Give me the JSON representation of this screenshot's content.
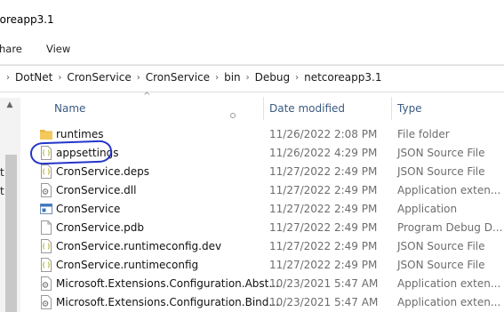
{
  "window": {
    "title": "coreapp3.1"
  },
  "ribbon": {
    "tabs": [
      "hare",
      "View"
    ]
  },
  "address": {
    "crumbs": [
      "DotNet",
      "CronService",
      "CronService",
      "bin",
      "Debug",
      "netcoreapp3.1"
    ]
  },
  "nav_pane": {
    "letters": [
      "t",
      "t"
    ]
  },
  "columns": {
    "name": "Name",
    "date": "Date modified",
    "type": "Type"
  },
  "files": [
    {
      "name": "runtimes",
      "date": "11/26/2022 2:08 PM",
      "type": "File folder",
      "icon": "folder-icon"
    },
    {
      "name": "appsettings",
      "date": "11/26/2022 4:29 PM",
      "type": "JSON Source File",
      "icon": "json-file-icon"
    },
    {
      "name": "CronService.deps",
      "date": "11/27/2022 2:49 PM",
      "type": "JSON Source File",
      "icon": "json-file-icon"
    },
    {
      "name": "CronService.dll",
      "date": "11/27/2022 2:49 PM",
      "type": "Application exten...",
      "icon": "dll-file-icon"
    },
    {
      "name": "CronService",
      "date": "11/27/2022 2:49 PM",
      "type": "Application",
      "icon": "exe-app-icon"
    },
    {
      "name": "CronService.pdb",
      "date": "11/27/2022 2:49 PM",
      "type": "Program Debug D...",
      "icon": "file-icon"
    },
    {
      "name": "CronService.runtimeconfig.dev",
      "date": "11/27/2022 2:49 PM",
      "type": "JSON Source File",
      "icon": "json-file-icon"
    },
    {
      "name": "CronService.runtimeconfig",
      "date": "11/27/2022 2:49 PM",
      "type": "JSON Source File",
      "icon": "json-file-icon"
    },
    {
      "name": "Microsoft.Extensions.Configuration.Abst...",
      "date": "10/23/2021 5:47 AM",
      "type": "Application exten...",
      "icon": "dll-file-icon"
    },
    {
      "name": "Microsoft.Extensions.Configuration.Bind...",
      "date": "10/23/2021 5:47 AM",
      "type": "Application exten...",
      "icon": "dll-file-icon"
    }
  ],
  "colors": {
    "folder": "#e8b94a",
    "column_header_text": "#3a5a80",
    "annotation_circle": "#2436c8"
  }
}
